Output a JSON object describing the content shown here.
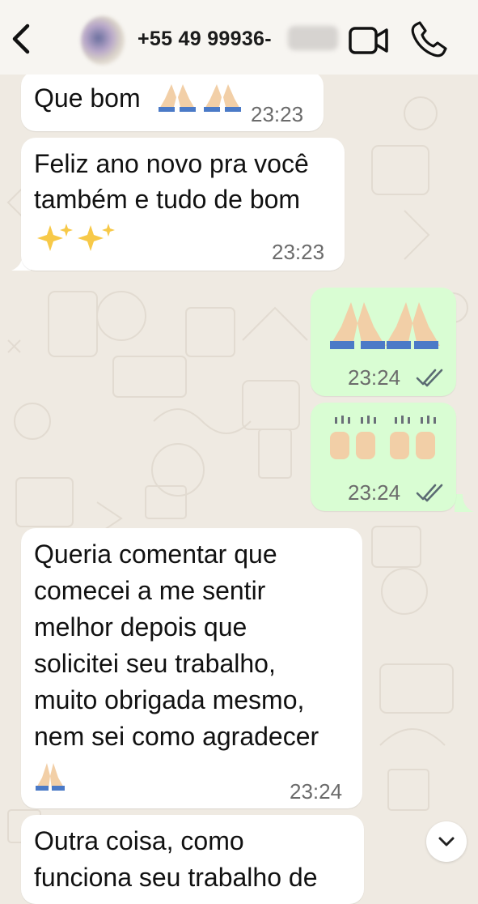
{
  "header": {
    "contact_name": "+55 49 99936-",
    "icons": {
      "back": "chevron-left-icon",
      "video": "video-camera-icon",
      "phone": "phone-icon"
    }
  },
  "messages": [
    {
      "dir": "in",
      "text_lines": [
        "Que bom"
      ],
      "emoji": "praying-hands x2",
      "time": "23:23"
    },
    {
      "dir": "in",
      "text_lines": [
        "Feliz ano novo pra você",
        "também e tudo de bom"
      ],
      "emoji": "sparkles x2",
      "time": "23:23"
    },
    {
      "dir": "out",
      "emoji": "praying-hands x2",
      "time": "23:24",
      "status": "read-double-check"
    },
    {
      "dir": "out",
      "emoji": "raising-hands x2",
      "time": "23:24",
      "status": "read-double-check"
    },
    {
      "dir": "in",
      "text_lines": [
        "Queria comentar que",
        "comecei a me sentir",
        "melhor depois que",
        "solicitei seu trabalho,",
        "muito obrigada mesmo,",
        "nem sei como agradecer"
      ],
      "emoji": "praying-hands",
      "time": "23:24"
    },
    {
      "dir": "in",
      "text_lines": [
        "Outra coisa, como",
        "funciona seu trabalho de"
      ]
    }
  ],
  "colors": {
    "background": "#efeae2",
    "incoming": "#ffffff",
    "outgoing": "#d9fdd3",
    "read_tick": "#5b6b73"
  },
  "scroll_button": {
    "icon": "chevron-down-icon"
  }
}
